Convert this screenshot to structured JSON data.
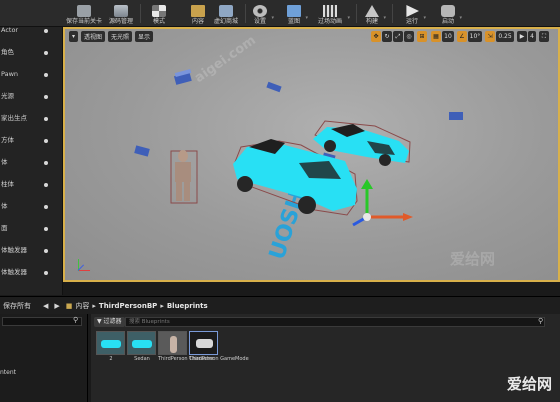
{
  "toolbar": {
    "buttons": [
      {
        "label": "保存当前关卡",
        "icon": "save-icon"
      },
      {
        "label": "源码管理",
        "icon": "source-control-icon"
      },
      {
        "label": "模式",
        "icon": "modes-icon"
      },
      {
        "label": "内容",
        "icon": "content-icon"
      },
      {
        "label": "虚幻商城",
        "icon": "marketplace-icon"
      },
      {
        "label": "设置",
        "icon": "settings-icon"
      },
      {
        "label": "蓝图",
        "icon": "blueprint-icon"
      },
      {
        "label": "过场动画",
        "icon": "cinematics-icon"
      },
      {
        "label": "构建",
        "icon": "build-icon"
      },
      {
        "label": "运行",
        "icon": "play-icon"
      },
      {
        "label": "启动",
        "icon": "launch-icon"
      }
    ]
  },
  "left_panel": {
    "items": [
      "Actor",
      "角色",
      "Pawn",
      "光源",
      "家出生点",
      "方体",
      "体",
      "柱体",
      "体",
      "面",
      "体触发器",
      "体触发器"
    ]
  },
  "viewport": {
    "perspective": "透视图",
    "lit": "无光照",
    "show": "显示",
    "grid_size": "10",
    "rotation_snap": "10°",
    "scale_snap": "0.25",
    "camera_speed": "4",
    "floor_text": "UOSHOT"
  },
  "bottom_bar": {
    "save_all": "保存所有",
    "content_label": "内容",
    "path_1": "ThirdPersonBP",
    "path_2": "Blueprints"
  },
  "content_browser": {
    "filter_label": "过滤器",
    "search_placeholder": "搜索 Blueprints",
    "left_item": "ntent",
    "assets": [
      {
        "name": "2"
      },
      {
        "name": "Sedan"
      },
      {
        "name": "ThirdPerson Character"
      },
      {
        "name": "ThirdPerson GameMode"
      }
    ]
  },
  "watermarks": [
    "爱给网",
    "aigei.com"
  ]
}
